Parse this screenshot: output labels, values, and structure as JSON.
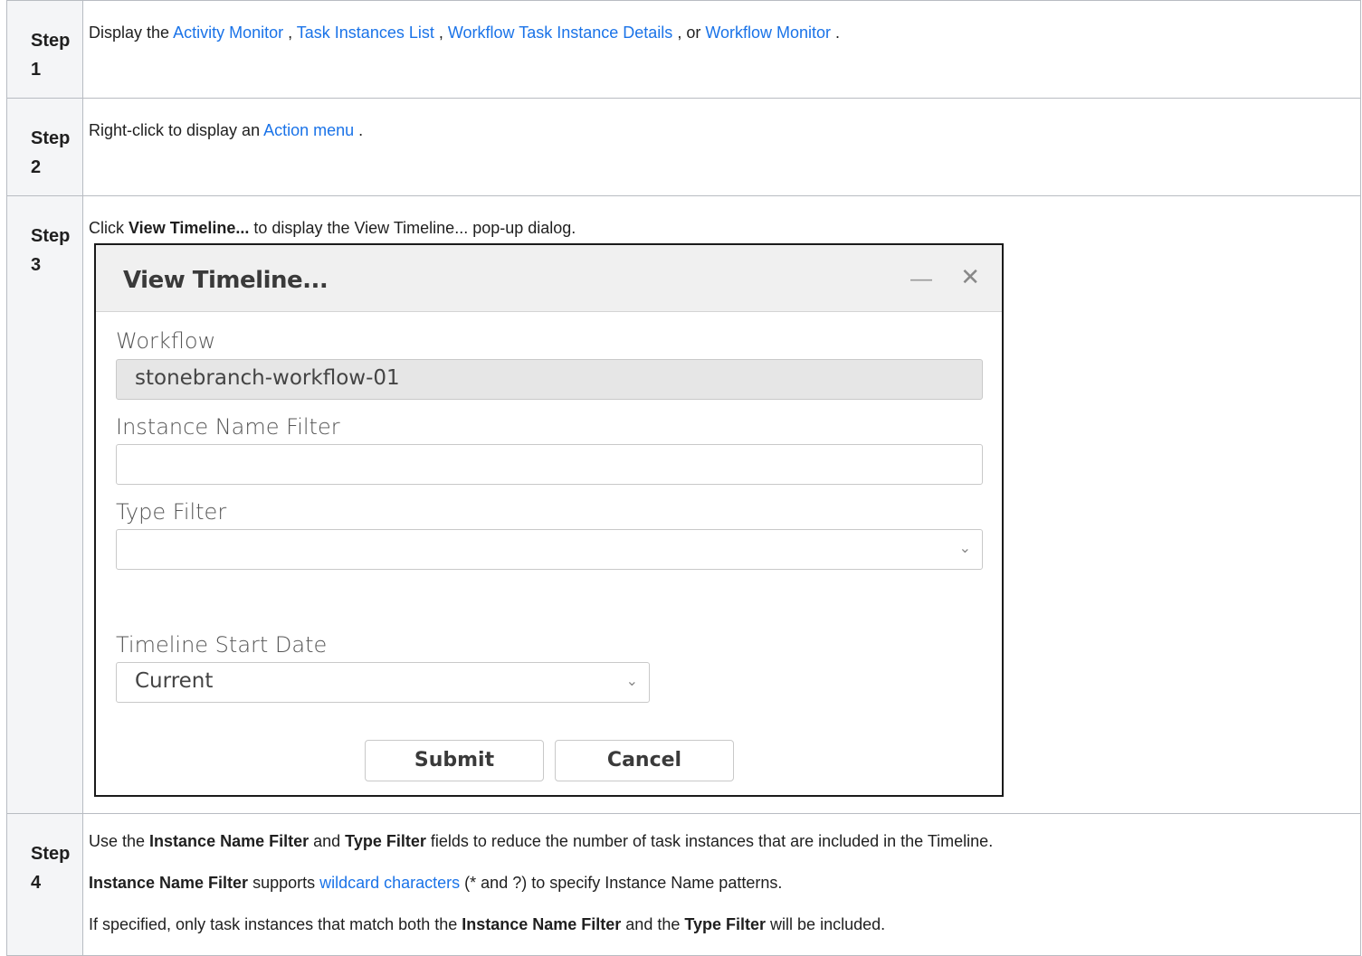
{
  "steps": [
    {
      "label": "Step 1",
      "text_prefix": "Display the ",
      "links": [
        "Activity Monitor",
        "Task Instances List",
        "Workflow Task Instance Details",
        "Workflow Monitor"
      ],
      "sep1": " ,  ",
      "sep2": " , ",
      "sep3": " , or ",
      "end": " ."
    },
    {
      "label": "Step 2",
      "text_prefix": "Right-click to display an  ",
      "link": "Action menu",
      "end": " ."
    },
    {
      "label": "Step 3",
      "text_prefix": "Click ",
      "bold": "View Timeline...",
      "text_suffix": " to display the View Timeline... pop-up dialog."
    },
    {
      "label": "Step 4",
      "line1": {
        "a": "Use the ",
        "b1": "Instance Name Filter",
        "c": " and ",
        "b2": "Type Filter",
        "d": " fields to reduce the number of task instances that are included in the Timeline."
      },
      "line2": {
        "b1": "Instance Name Filter",
        "a": " supports ",
        "link": "wildcard characters",
        "c": " (* and ?) to specify Instance Name patterns."
      },
      "line3": {
        "a": "If specified, only task instances that match both the ",
        "b1": "Instance Name Filter",
        "c": " and the ",
        "b2": "Type Filter",
        "d": " will be included."
      }
    }
  ],
  "dialog": {
    "title": "View Timeline...",
    "minimize_glyph": "—",
    "close_glyph": "✕",
    "workflow_label": "Workflow",
    "workflow_value": "stonebranch-workflow-01",
    "instance_filter_label": "Instance Name Filter",
    "instance_filter_value": "",
    "type_filter_label": "Type Filter",
    "type_filter_value": "",
    "start_date_label": "Timeline Start Date",
    "start_date_value": "Current",
    "chevron_glyph": "⌄",
    "submit_label": "Submit",
    "cancel_label": "Cancel"
  },
  "colors": {
    "link": "#1a73e8",
    "step_header_bg": "#f4f5f7",
    "border": "#b8bcc2"
  }
}
